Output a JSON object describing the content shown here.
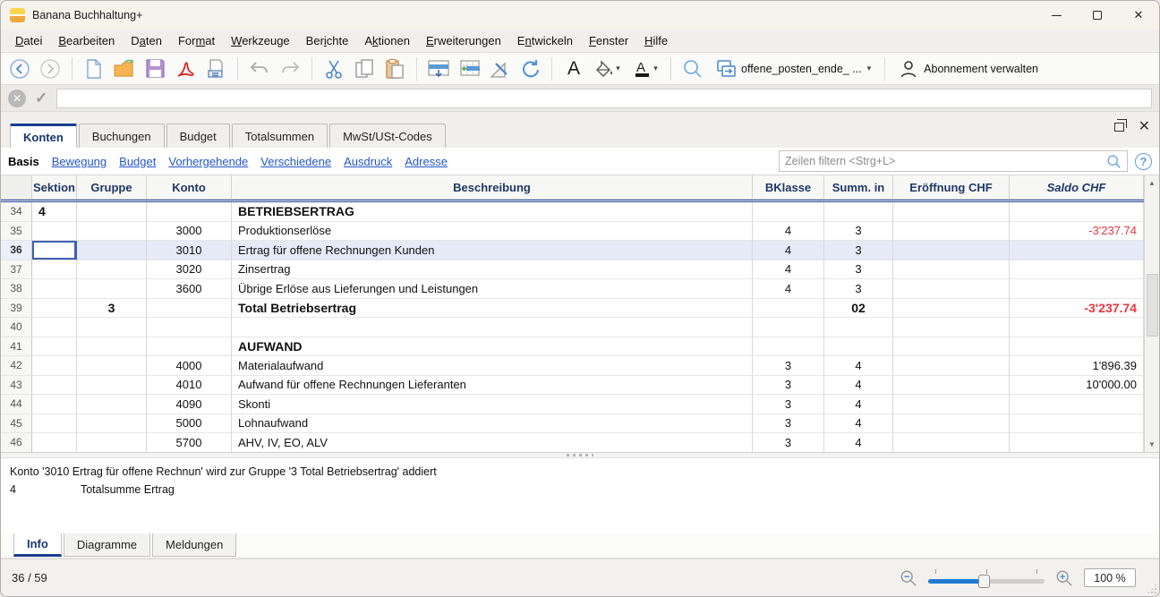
{
  "window": {
    "title": "Banana Buchhaltung+"
  },
  "menu": {
    "items": [
      {
        "label": "Datei",
        "u": 0
      },
      {
        "label": "Bearbeiten",
        "u": 0
      },
      {
        "label": "Daten",
        "u": 1
      },
      {
        "label": "Format",
        "u": 3
      },
      {
        "label": "Werkzeuge",
        "u": 0
      },
      {
        "label": "Berichte",
        "u": 3
      },
      {
        "label": "Aktionen",
        "u": 1
      },
      {
        "label": "Erweiterungen",
        "u": 0
      },
      {
        "label": "Entwickeln",
        "u": 1
      },
      {
        "label": "Fenster",
        "u": 0
      },
      {
        "label": "Hilfe",
        "u": 0
      }
    ]
  },
  "toolbar": {
    "buttons": [
      "back",
      "forward",
      "new-file",
      "open-file",
      "save",
      "export-pdf",
      "print",
      "undo",
      "redo",
      "cut",
      "copy",
      "paste",
      "insert-rows",
      "append-rows",
      "design",
      "recalculate",
      "font",
      "fill-color",
      "font-color",
      "search",
      "window-switcher"
    ],
    "document_name": "offene_posten_ende_ ...",
    "subscription_label": "Abonnement verwalten"
  },
  "formula_bar": {
    "value": ""
  },
  "tabs": {
    "items": [
      {
        "label": "Konten",
        "active": true
      },
      {
        "label": "Buchungen",
        "active": false
      },
      {
        "label": "Budget",
        "active": false
      },
      {
        "label": "Totalsummen",
        "active": false
      },
      {
        "label": "MwSt/USt-Codes",
        "active": false
      }
    ]
  },
  "views": {
    "current": "Basis",
    "links": [
      "Bewegung",
      "Budget",
      "Vorhergehende",
      "Verschiedene",
      "Ausdruck",
      "Adresse"
    ]
  },
  "filter": {
    "placeholder": "Zeilen filtern <Strg+L>"
  },
  "table": {
    "columns": [
      "Sektion",
      "Gruppe",
      "Konto",
      "Beschreibung",
      "BKlasse",
      "Summ. in",
      "Eröffnung CHF",
      "Saldo CHF"
    ],
    "rows": [
      {
        "num": 34,
        "sektion": "4",
        "gruppe": "",
        "konto": "",
        "beschreibung": "BETRIEBSERTRAG",
        "bklasse": "",
        "summ": "",
        "eroeffnung": "",
        "saldo": "",
        "bold": true
      },
      {
        "num": 35,
        "sektion": "",
        "gruppe": "",
        "konto": "3000",
        "beschreibung": "Produktionserlöse",
        "bklasse": "4",
        "summ": "3",
        "eroeffnung": "",
        "saldo": "-3'237.74"
      },
      {
        "num": 36,
        "sektion": "",
        "gruppe": "",
        "konto": "3010",
        "beschreibung": "Ertrag für offene Rechnungen Kunden",
        "bklasse": "4",
        "summ": "3",
        "eroeffnung": "",
        "saldo": "",
        "selected": true,
        "cursor_cell": "sektion"
      },
      {
        "num": 37,
        "sektion": "",
        "gruppe": "",
        "konto": "3020",
        "beschreibung": "Zinsertrag",
        "bklasse": "4",
        "summ": "3",
        "eroeffnung": "",
        "saldo": ""
      },
      {
        "num": 38,
        "sektion": "",
        "gruppe": "",
        "konto": "3600",
        "beschreibung": "Übrige Erlöse aus Lieferungen und Leistungen",
        "bklasse": "4",
        "summ": "3",
        "eroeffnung": "",
        "saldo": ""
      },
      {
        "num": 39,
        "sektion": "",
        "gruppe": "3",
        "konto": "",
        "beschreibung": "Total Betriebsertrag",
        "bklasse": "",
        "summ": "02",
        "eroeffnung": "",
        "saldo": "-3'237.74",
        "bold": true
      },
      {
        "num": 40,
        "sektion": "",
        "gruppe": "",
        "konto": "",
        "beschreibung": "",
        "bklasse": "",
        "summ": "",
        "eroeffnung": "",
        "saldo": ""
      },
      {
        "num": 41,
        "sektion": "",
        "gruppe": "",
        "konto": "",
        "beschreibung": "AUFWAND",
        "bklasse": "",
        "summ": "",
        "eroeffnung": "",
        "saldo": "",
        "bold": true
      },
      {
        "num": 42,
        "sektion": "",
        "gruppe": "",
        "konto": "4000",
        "beschreibung": "Materialaufwand",
        "bklasse": "3",
        "summ": "4",
        "eroeffnung": "",
        "saldo": "1'896.39"
      },
      {
        "num": 43,
        "sektion": "",
        "gruppe": "",
        "konto": "4010",
        "beschreibung": "Aufwand für offene Rechnungen Lieferanten",
        "bklasse": "3",
        "summ": "4",
        "eroeffnung": "",
        "saldo": "10'000.00"
      },
      {
        "num": 44,
        "sektion": "",
        "gruppe": "",
        "konto": "4090",
        "beschreibung": "Skonti",
        "bklasse": "3",
        "summ": "4",
        "eroeffnung": "",
        "saldo": ""
      },
      {
        "num": 45,
        "sektion": "",
        "gruppe": "",
        "konto": "5000",
        "beschreibung": "Lohnaufwand",
        "bklasse": "3",
        "summ": "4",
        "eroeffnung": "",
        "saldo": ""
      },
      {
        "num": 46,
        "sektion": "",
        "gruppe": "",
        "konto": "5700",
        "beschreibung": "AHV, IV, EO, ALV",
        "bklasse": "3",
        "summ": "4",
        "eroeffnung": "",
        "saldo": ""
      }
    ]
  },
  "info_panel": {
    "line1": "Konto '3010 Ertrag für offene Rechnun' wird zur Gruppe '3 Total Betriebsertrag' addiert",
    "line2_left": "4",
    "line2_right": "Totalsumme Ertrag"
  },
  "bottom_tabs": {
    "items": [
      {
        "label": "Info",
        "active": true
      },
      {
        "label": "Diagramme",
        "active": false
      },
      {
        "label": "Meldungen",
        "active": false
      }
    ]
  },
  "status_bar": {
    "position": "36 / 59",
    "zoom_level": "100 %"
  },
  "colors": {
    "accent_navy": "#1a3e8f",
    "negative_red": "#ee3340",
    "selection": "#e6e9f6",
    "link_blue": "#2356c5"
  }
}
